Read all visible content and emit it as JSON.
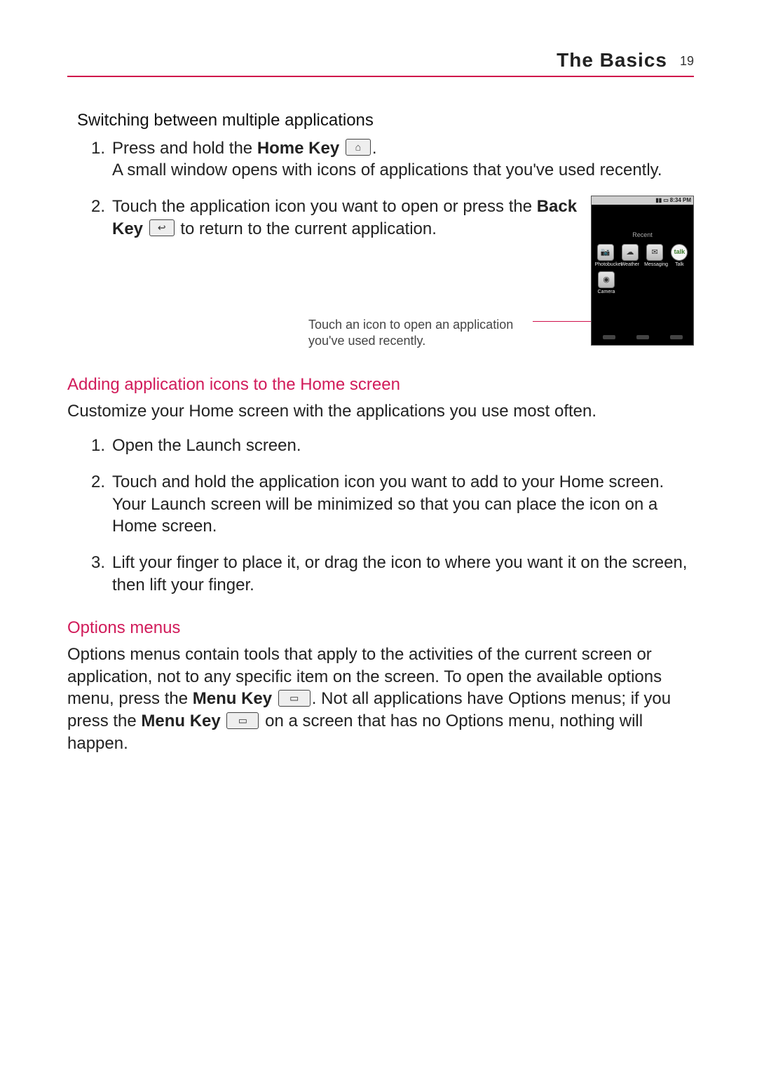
{
  "header": {
    "section_title": "The Basics",
    "page_number": "19"
  },
  "section_switching": {
    "heading": "Switching between multiple applications",
    "steps": [
      {
        "num": "1.",
        "prefix": "Press and hold the ",
        "bold": "Home Key",
        "suffix": " ",
        "after_icon": ".",
        "line2": "A small window opens with icons of applications that you've used recently."
      },
      {
        "num": "2.",
        "prefix": "Touch the application icon you want to open or press the ",
        "bold": "Back Key",
        "suffix": " ",
        "after_icon": " to return to the current application."
      }
    ],
    "callout": "Touch an icon to open an application you've used recently."
  },
  "phone": {
    "status_time": "8:34 PM",
    "recent_label": "Recent",
    "apps_row1": [
      {
        "icon_glyph": "📷",
        "label": "Photobucket"
      },
      {
        "icon_glyph": "☁",
        "label": "Weather"
      },
      {
        "icon_glyph": "✉",
        "label": "Messaging"
      },
      {
        "icon_glyph": "talk",
        "label": "Talk",
        "variant": "talk"
      }
    ],
    "apps_row2": [
      {
        "icon_glyph": "◉",
        "label": "Camera"
      }
    ]
  },
  "section_adding": {
    "heading": "Adding application icons to the Home screen",
    "intro": "Customize your Home screen with the applications you use most often.",
    "steps": [
      {
        "num": "1.",
        "text": "Open the Launch screen."
      },
      {
        "num": "2.",
        "text": "Touch and hold the application icon you want to add to your Home screen. Your Launch screen will be minimized so that you can place the icon on a Home screen."
      },
      {
        "num": "3.",
        "text": "Lift your finger to place it, or drag the icon to where you want it on the screen, then lift your finger."
      }
    ]
  },
  "section_options": {
    "heading": "Options menus",
    "p_part1": "Options menus contain tools that apply to the activities of the current screen or application, not to any specific item on the screen. To open the available options menu, press the ",
    "bold1": "Menu Key",
    "p_part2": ". Not all applications have Options menus; if you press the ",
    "bold2": "Menu Key",
    "p_part3": " on a screen that has no Options menu, nothing will happen."
  },
  "icons": {
    "home_glyph": "⌂",
    "back_glyph": "↩",
    "menu_glyph": "▭"
  }
}
